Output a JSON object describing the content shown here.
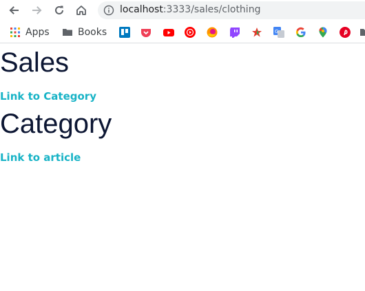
{
  "browser": {
    "url_host": "localhost",
    "url_rest": ":3333/sales/clothing"
  },
  "bookmarks": {
    "apps_label": "Apps",
    "books_label": "Books",
    "icons": [
      "trello-icon",
      "pocket-icon",
      "youtube-icon",
      "youtube-music-icon",
      "firefox-icon",
      "twitch-icon",
      "star-icon",
      "translate-icon",
      "google-icon",
      "maps-icon",
      "pinterest-icon",
      "folder-icon"
    ]
  },
  "page": {
    "heading_1": "Sales",
    "link_1": "Link to Category",
    "heading_2": "Category",
    "link_2": "Link to article"
  }
}
